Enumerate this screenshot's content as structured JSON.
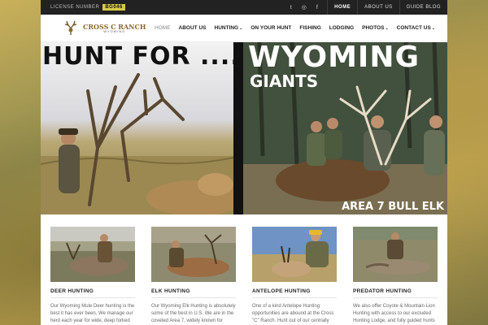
{
  "topbar": {
    "license_label": "LICENSE NUMBER",
    "license_number": "BG046",
    "social": [
      {
        "icon": "twitter-icon",
        "glyph": "t"
      },
      {
        "icon": "instagram-icon",
        "glyph": "◎"
      },
      {
        "icon": "facebook-icon",
        "glyph": "f"
      }
    ],
    "links": [
      {
        "label": "HOME",
        "active": true
      },
      {
        "label": "ABOUT US",
        "active": false
      },
      {
        "label": "GUIDE BLOG",
        "active": false
      }
    ]
  },
  "logo": {
    "main": "CROSS C RANCH",
    "sub": "WYOMING"
  },
  "nav": {
    "home": "HOME",
    "about": "ABOUT US",
    "hunting": "HUNTING",
    "on_your_hunt": "ON YOUR HUNT",
    "fishing": "FISHING",
    "lodging": "LODGING",
    "photos": "PHOTOS",
    "contact": "CONTACT US",
    "caret": "⌄"
  },
  "hero": {
    "title_left": "HUNT FOR ....",
    "title_right": "WYOMING",
    "subtitle_right": "GIANTS",
    "caption": "AREA 7 BULL ELK"
  },
  "cards": [
    {
      "title": "DEER HUNTING",
      "text": "Our Wyoming Mule Deer hunting is the best it has ever been. We manage our herd each year for wide, deep forked"
    },
    {
      "title": "ELK HUNTING",
      "text": "Our Wyoming Elk Hunting is absolutely some of the best in U.S. We are in the coveted Area 7, widely known for"
    },
    {
      "title": "ANTELOPE HUNTING",
      "text": "One of a kind Antelope Hunting opportunities are abound at the Cross \"C\" Ranch. Hunt out of our centrally"
    },
    {
      "title": "PREDATOR HUNTING",
      "text": "We also offer Coyote & Mountain Lion Hunting with access to our excluded Hunting Lodge, and fully guided hunts"
    }
  ],
  "colors": {
    "license_badge": "#d8c94a",
    "topbar": "#222222",
    "accent_gold": "#8a6a2a"
  }
}
